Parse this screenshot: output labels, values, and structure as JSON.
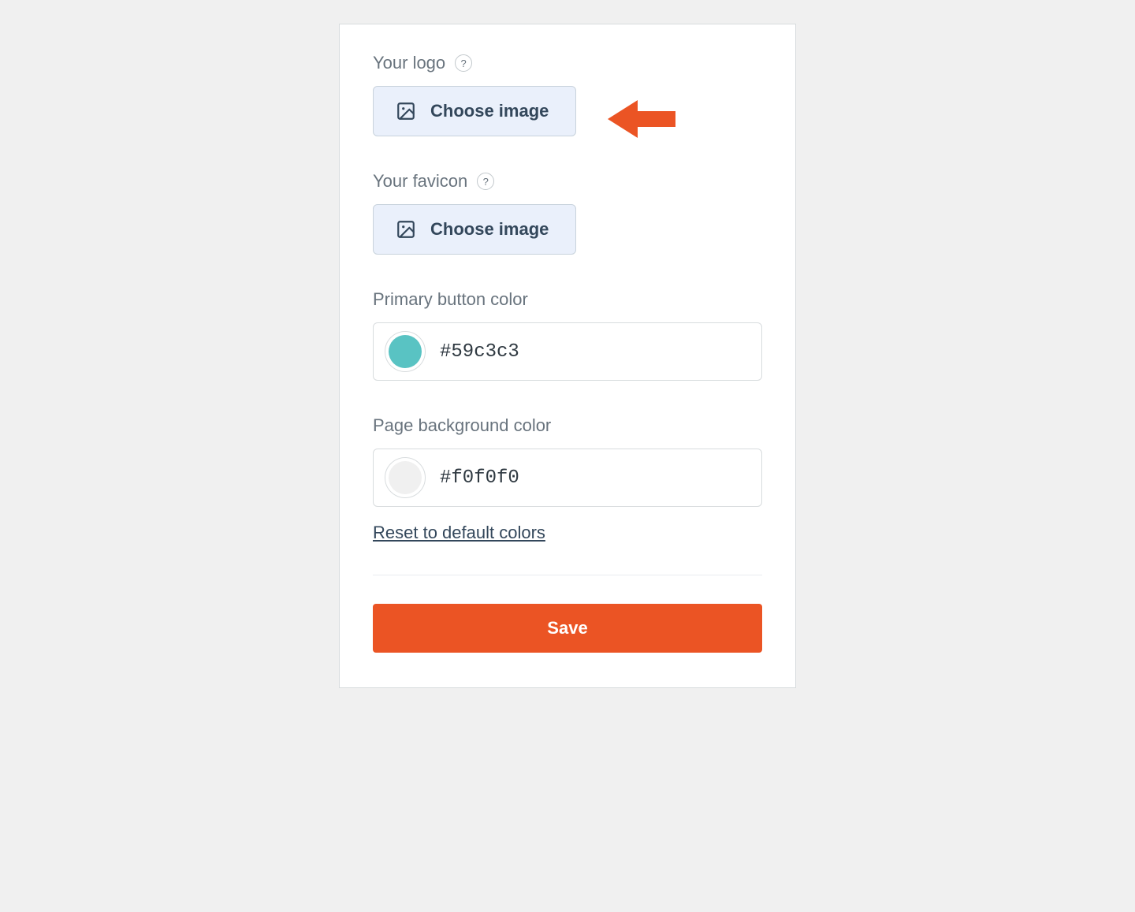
{
  "logo": {
    "label": "Your logo",
    "button_label": "Choose image"
  },
  "favicon": {
    "label": "Your favicon",
    "button_label": "Choose image"
  },
  "primary_color": {
    "label": "Primary button color",
    "value": "#59c3c3",
    "swatch": "#59c3c3"
  },
  "background_color": {
    "label": "Page background color",
    "value": "#f0f0f0",
    "swatch": "#f0f0f0"
  },
  "reset_label": "Reset to default colors",
  "save_label": "Save",
  "help_glyph": "?",
  "colors": {
    "accent": "#eb5424",
    "panel_border": "#d8dcde",
    "choose_bg": "#eaf0fb"
  }
}
